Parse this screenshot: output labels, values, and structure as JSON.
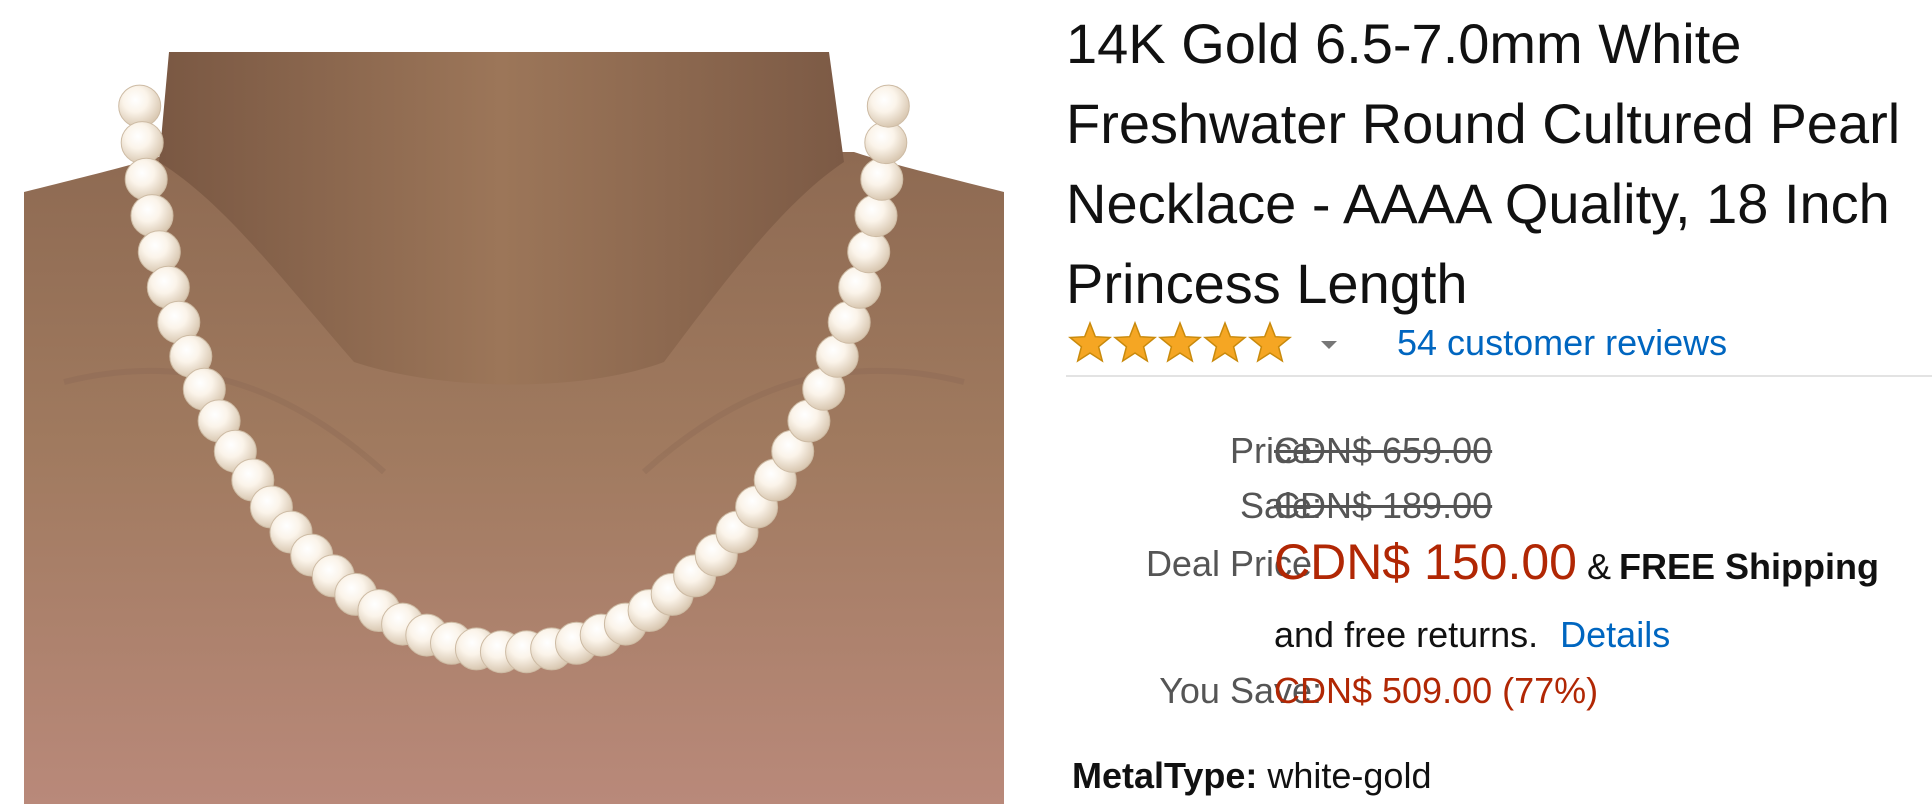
{
  "product": {
    "title": "14K Gold 6.5-7.0mm White Freshwater Round Cultured Pearl Necklace - AAAA Quality, 18 Inch Princess Length",
    "image_alt": "Pearl necklace worn on neck"
  },
  "rating": {
    "stars": 5,
    "max_stars": 5,
    "star_color": "#f5a623",
    "reviews_link": "54 customer reviews"
  },
  "pricing": {
    "price_label": "Price:",
    "price_value": "CDN$ 659.00",
    "sale_label": "Sale:",
    "sale_value": "CDN$ 189.00",
    "deal_label": "Deal Price:",
    "deal_value": "CDN$ 150.00",
    "shipping_amp": "&",
    "shipping_text": "FREE Shipping",
    "returns_text": "and free returns.",
    "details_link": "Details",
    "save_label": "You Save:",
    "save_value": "CDN$ 509.00 (77%)",
    "deal_color": "#b12704",
    "link_color": "#0066c0"
  },
  "attributes": {
    "metal_label": "MetalType:",
    "metal_value": "white-gold"
  }
}
